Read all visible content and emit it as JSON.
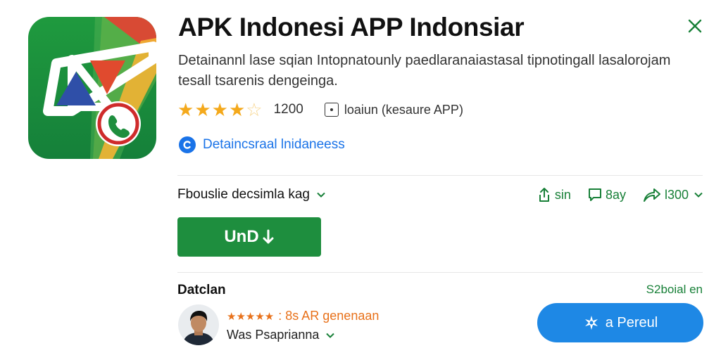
{
  "app": {
    "title": "APK Indonesi APP Indonsiar",
    "description": "Detainannl lase sqian Intopnatounly paedlaranaiastasal tipnotingall lasalorojam tesall tsarenis dengeinga.",
    "rating_count": "1200",
    "info_text": "loaiun (kesaure APP)",
    "rating_stars": 4.5,
    "developer_link": "Detaincsraal lnidaneess",
    "icon_name": "app-logo-icon"
  },
  "version": {
    "label": "Fbouslie decsimla kag"
  },
  "actions": [
    {
      "label": "sin",
      "icon": "share-icon"
    },
    {
      "label": "8ay",
      "icon": "message-icon"
    },
    {
      "label": "l300",
      "icon": "forward-icon"
    }
  ],
  "install": {
    "label": "UnD"
  },
  "reviews": {
    "title": "Datclan",
    "see_all": "S2boial en",
    "review": {
      "stars": "★★★★★",
      "text": ": 8s AR genenaan",
      "reviewer": "Was Psaprianna",
      "rating": 5
    },
    "rate_button": "a Pereul"
  },
  "colors": {
    "install": "#1e8e3e",
    "accent_green": "#188038",
    "link_blue": "#1a73e8",
    "rate_blue": "#1e88e5",
    "star": "#f4a91c",
    "review_orange": "#e8711a"
  }
}
